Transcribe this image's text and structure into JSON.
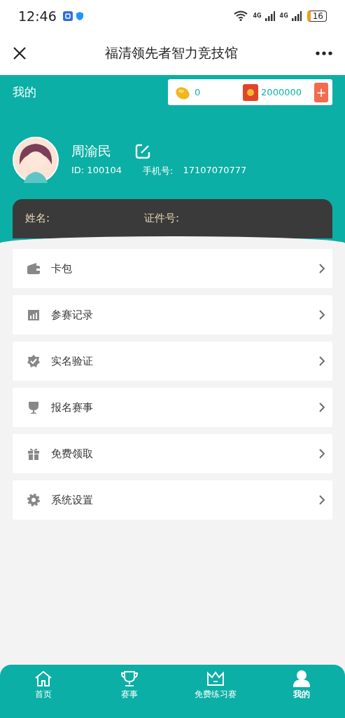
{
  "status_bar": {
    "time": "12:46",
    "battery": "16",
    "network_1": "4G",
    "network_2": "4G"
  },
  "nav_bar": {
    "title": "福清领先者智力竞技馆"
  },
  "header": {
    "title": "我的",
    "beans": "0",
    "coupons": "2000000",
    "add": "+"
  },
  "profile": {
    "name": "周渝民",
    "id": "ID: 100104",
    "phone_label": "手机号:",
    "phone": "17107070777"
  },
  "id_card": {
    "name_label": "姓名:",
    "cert_label": "证件号:"
  },
  "menu": [
    {
      "label": "卡包"
    },
    {
      "label": "参赛记录"
    },
    {
      "label": "实名验证"
    },
    {
      "label": "报名赛事"
    },
    {
      "label": "免费领取"
    },
    {
      "label": "系统设置"
    }
  ],
  "tabs": [
    {
      "label": "首页",
      "selected": false
    },
    {
      "label": "赛事",
      "selected": false
    },
    {
      "label": "免费练习赛",
      "selected": false
    },
    {
      "label": "我的",
      "selected": true
    }
  ]
}
